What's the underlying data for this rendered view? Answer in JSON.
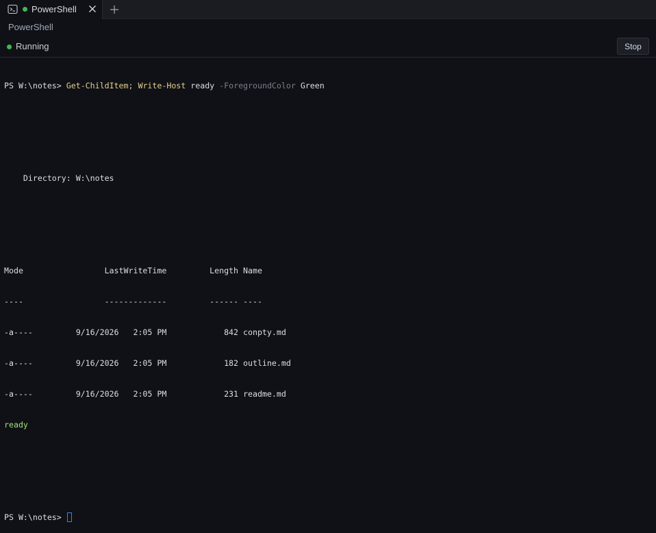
{
  "tabs": [
    {
      "title": "PowerShell",
      "icon": "terminal-icon",
      "status_color": "#3fb950"
    }
  ],
  "window": {
    "subtitle": "PowerShell"
  },
  "status": {
    "text": "Running",
    "color": "#3fb950",
    "stop_label": "Stop"
  },
  "terminal": {
    "prompt": "PS W:\\notes> ",
    "command_parts": {
      "cmd1": "Get-ChildItem;",
      "cmd2": "Write-Host",
      "arg1": "ready",
      "param": "-ForegroundColor",
      "arg2": "Green"
    },
    "directory_line": "    Directory: W:\\notes",
    "header": "Mode                 LastWriteTime         Length Name",
    "separator": "----                 -------------         ------ ----",
    "rows": [
      "-a----         9/16/2026   2:05 PM            842 conpty.md",
      "-a----         9/16/2026   2:05 PM            182 outline.md",
      "-a----         9/16/2026   2:05 PM            231 readme.md"
    ],
    "ready_text": "ready",
    "final_prompt": "PS W:\\notes> "
  }
}
